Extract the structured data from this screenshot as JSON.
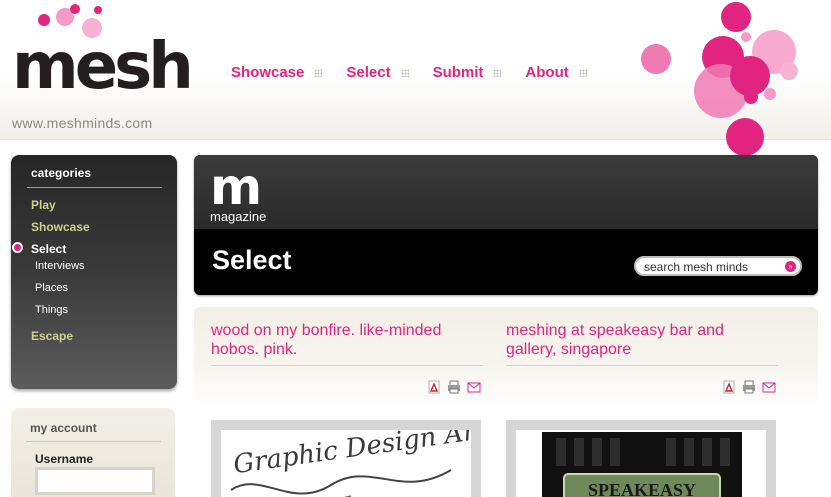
{
  "site": {
    "logo_text": "mesh",
    "url": "www.meshminds.com"
  },
  "nav": {
    "items": [
      {
        "label": "Showcase"
      },
      {
        "label": "Select"
      },
      {
        "label": "Submit"
      },
      {
        "label": "About"
      }
    ]
  },
  "categories": {
    "title": "categories",
    "items": [
      {
        "label": "Play"
      },
      {
        "label": "Showcase"
      },
      {
        "label": "Select"
      },
      {
        "label": "Escape"
      }
    ],
    "subitems": [
      {
        "label": "Interviews"
      },
      {
        "label": "Places"
      },
      {
        "label": "Things"
      }
    ]
  },
  "account": {
    "title": "my account",
    "username_label": "Username"
  },
  "magazine": {
    "logo_letter": "m",
    "logo_label": "magazine",
    "title": "Select"
  },
  "search": {
    "placeholder": "search mesh minds"
  },
  "articles": [
    {
      "title": "wood on my bonfire. like-minded hobos. pink."
    },
    {
      "title": "meshing at speakeasy bar and gallery, singapore"
    }
  ],
  "thumbnail_text": {
    "speakeasy": "SPEAKEASY",
    "handwriting": "Graphic Design Art"
  },
  "colors": {
    "accent": "#e0247f",
    "category_text": "#cdd18e",
    "dark_panel": "#2a2a2a"
  }
}
